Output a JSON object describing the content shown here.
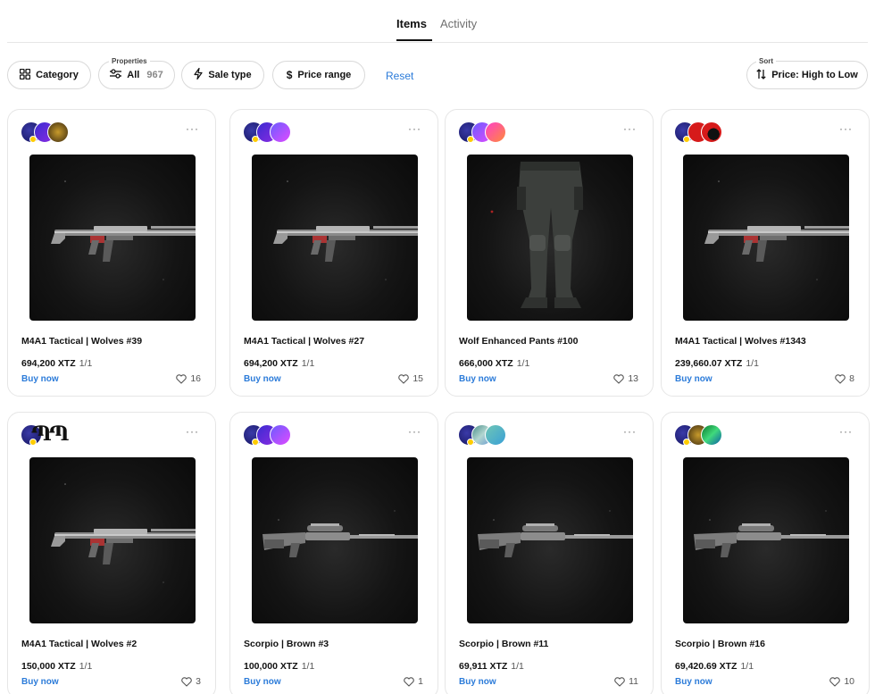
{
  "tabs": {
    "items": "Items",
    "activity": "Activity"
  },
  "filters": {
    "category": "Category",
    "properties_label": "Properties",
    "properties_value": "All",
    "properties_count": "967",
    "sale_type": "Sale type",
    "price_range": "Price range",
    "reset": "Reset",
    "sort_label": "Sort",
    "sort_value": "Price: High to Low"
  },
  "icons": {
    "category": "grid-icon",
    "properties": "sliders-icon",
    "sale_type": "lightning-icon",
    "price_range": "dollar-icon",
    "sort": "sort-arrows-icon",
    "more": "more-icon",
    "like": "heart-icon"
  },
  "colors": {
    "link": "#2b7bd9",
    "text": "#111111",
    "border": "#e6e6e6"
  },
  "cards": [
    {
      "title": "M4A1 Tactical | Wolves #39",
      "price": "694,200 XTZ",
      "edition": "1/1",
      "buy": "Buy now",
      "likes": "16",
      "media": "rifle"
    },
    {
      "title": "M4A1 Tactical | Wolves #27",
      "price": "694,200 XTZ",
      "edition": "1/1",
      "buy": "Buy now",
      "likes": "15",
      "media": "rifle"
    },
    {
      "title": "Wolf Enhanced Pants #100",
      "price": "666,000 XTZ",
      "edition": "1/1",
      "buy": "Buy now",
      "likes": "13",
      "media": "pants"
    },
    {
      "title": "M4A1 Tactical | Wolves #1343",
      "price": "239,660.07 XTZ",
      "edition": "1/1",
      "buy": "Buy now",
      "likes": "8",
      "media": "rifle"
    },
    {
      "title": "M4A1 Tactical | Wolves #2",
      "price": "150,000 XTZ",
      "edition": "1/1",
      "buy": "Buy now",
      "likes": "3",
      "media": "rifle"
    },
    {
      "title": "Scorpio | Brown #3",
      "price": "100,000 XTZ",
      "edition": "1/1",
      "buy": "Buy now",
      "likes": "1",
      "media": "sniper"
    },
    {
      "title": "Scorpio | Brown #11",
      "price": "69,911 XTZ",
      "edition": "1/1",
      "buy": "Buy now",
      "likes": "11",
      "media": "sniper"
    },
    {
      "title": "Scorpio | Brown #16",
      "price": "69,420.69 XTZ",
      "edition": "1/1",
      "buy": "Buy now",
      "likes": "10",
      "media": "sniper"
    }
  ]
}
